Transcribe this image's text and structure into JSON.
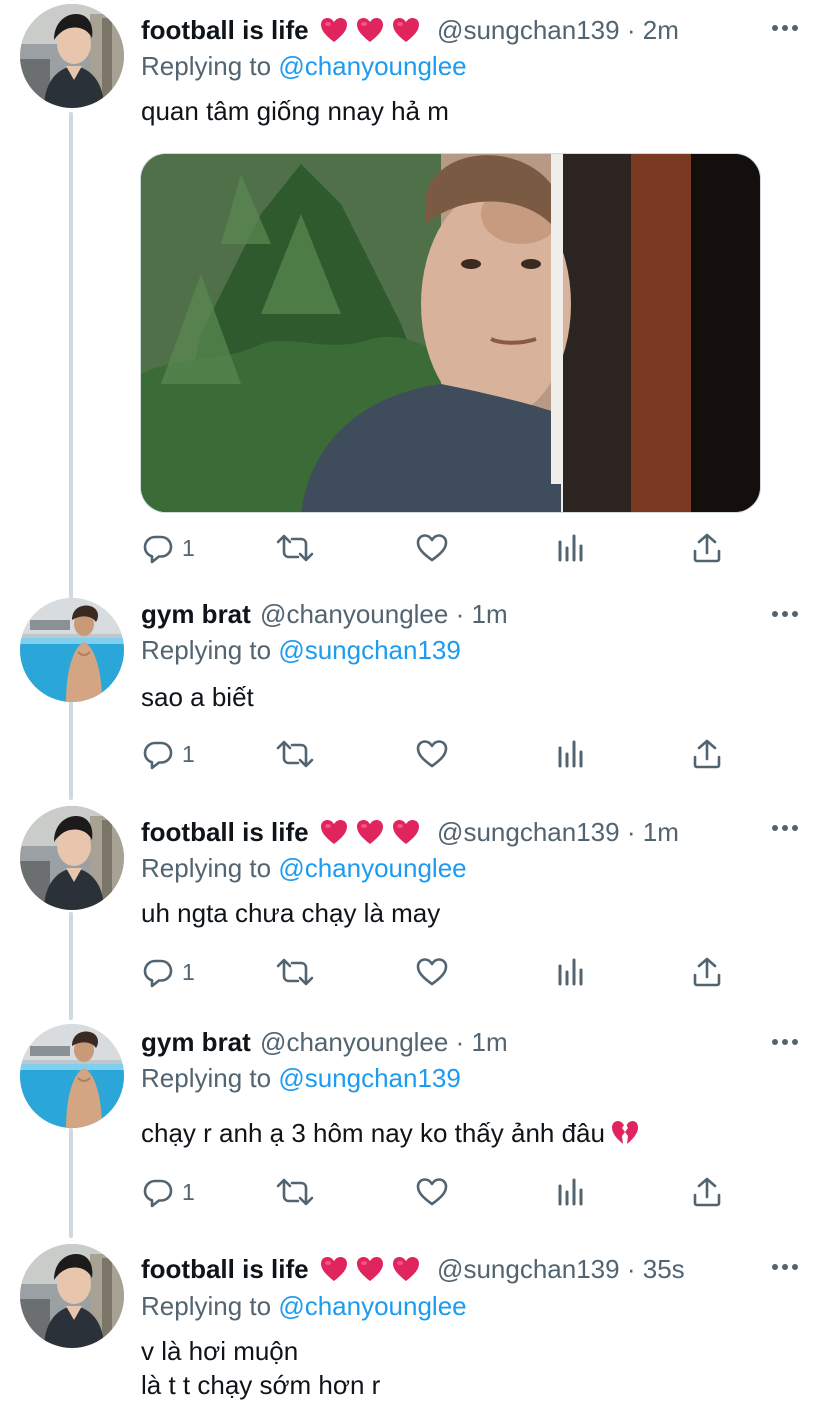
{
  "colors": {
    "text": "#0f1419",
    "muted": "#536471",
    "link": "#1d9bf0",
    "heart": "#e0245e",
    "thread_line": "#cfd9de"
  },
  "tweets": [
    {
      "name": "football is life",
      "hearts": [
        "red-heart-emoji",
        "red-heart-emoji",
        "red-heart-emoji"
      ],
      "handle": "@sungchan139",
      "separator": "·",
      "time": "2m",
      "replying_prefix": "Replying to ",
      "replying_to": "@chanyounglee",
      "text": "quan tâm giống nnay hả m",
      "has_media": true,
      "reply_count": "1"
    },
    {
      "name": "gym brat",
      "hearts": [],
      "handle": "@chanyounglee",
      "separator": "·",
      "time": "1m",
      "replying_prefix": "Replying to ",
      "replying_to": "@sungchan139",
      "text": "sao a biết",
      "reply_count": "1"
    },
    {
      "name": "football is life",
      "hearts": [
        "red-heart-emoji",
        "red-heart-emoji",
        "red-heart-emoji"
      ],
      "handle": "@sungchan139",
      "separator": "·",
      "time": "1m",
      "replying_prefix": "Replying to ",
      "replying_to": "@chanyounglee",
      "text": "uh ngta chưa chạy là may",
      "reply_count": "1"
    },
    {
      "name": "gym brat",
      "hearts": [],
      "handle": "@chanyounglee",
      "separator": "·",
      "time": "1m",
      "replying_prefix": "Replying to ",
      "replying_to": "@sungchan139",
      "text": "chạy r anh ạ 3 hôm nay ko thấy ảnh đâu",
      "trailing_emoji": "broken-heart-emoji",
      "reply_count": "1"
    },
    {
      "name": "football is life",
      "hearts": [
        "red-heart-emoji",
        "red-heart-emoji",
        "red-heart-emoji"
      ],
      "handle": "@sungchan139",
      "separator": "·",
      "time": "35s",
      "replying_prefix": "Replying to ",
      "replying_to": "@chanyounglee",
      "text_line1": "v là hơi muộn",
      "text_line2": "là t t chạy sớm hơn r"
    }
  ]
}
